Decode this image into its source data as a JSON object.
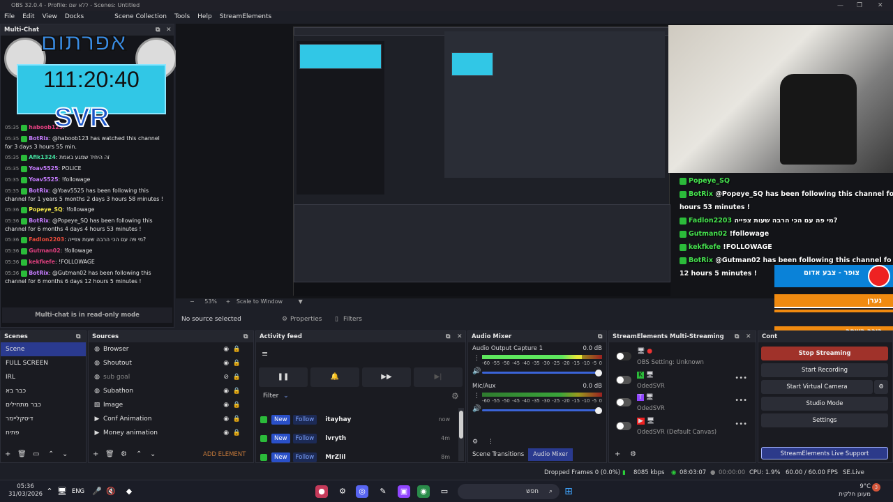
{
  "window": {
    "title": "OBS 32.0.4 - Profile: ללא שם - Scenes: Untitled"
  },
  "menu": [
    "File",
    "Edit",
    "View",
    "Docks",
    "Scene Collection",
    "Tools",
    "Help",
    "StreamElements"
  ],
  "multichat": {
    "title": "Multi-Chat",
    "footer": "Multi-chat is in read-only mode",
    "overlay": {
      "banner": "אפרתום",
      "timer": "111:20:40",
      "brand": "SVR"
    },
    "messages": [
      {
        "ts": "05:35",
        "user": "haboob123",
        "text": "",
        "color": "#e0407f"
      },
      {
        "ts": "05:35",
        "user": "BotRix",
        "text": "@haboob123 has watched this channel for 3 days 3 hours 55 min.",
        "color": "#c77dff"
      },
      {
        "ts": "05:35",
        "user": "Afik1324",
        "text": "זה היחיד שמגע באמת",
        "color": "#44e0a0"
      },
      {
        "ts": "05:35",
        "user": "Yoav5525",
        "text": "POLICE",
        "color": "#c77dff"
      },
      {
        "ts": "05:35",
        "user": "Yoav5525",
        "text": "!followage",
        "color": "#c77dff"
      },
      {
        "ts": "05:35",
        "user": "BotRix",
        "text": "@Yoav5525 has been following this channel for 1 years 5 months 2 days 3 hours 58 minutes !",
        "color": "#c77dff"
      },
      {
        "ts": "05:36",
        "user": "Popeye_SQ",
        "text": "!followage",
        "color": "#f0e44a"
      },
      {
        "ts": "05:36",
        "user": "BotRix",
        "text": "@Popeye_SQ has been following this channel for 6 months 4 days 4 hours 53 minutes !",
        "color": "#c77dff"
      },
      {
        "ts": "05:36",
        "user": "Fadlon2203",
        "text": "מי פה עם הכי הרבה שעות צפייה?",
        "color": "#e84a3a"
      },
      {
        "ts": "05:36",
        "user": "Gutman02",
        "text": "!followage",
        "color": "#e0407f"
      },
      {
        "ts": "05:36",
        "user": "kekfkefe",
        "text": "!FOLLOWAGE",
        "color": "#e0407f"
      },
      {
        "ts": "05:36",
        "user": "BotRix",
        "text": "@Gutman02 has been following this channel for 6 months 6 days 12 hours 5 minutes !",
        "color": "#c77dff"
      }
    ]
  },
  "preview": {
    "zoom": "53%",
    "scale_mode": "Scale to Window",
    "overlay_chat": [
      {
        "user": "Popeye_SQ",
        "text": ""
      },
      {
        "user": "BotRix",
        "text": "@Popeye_SQ has been following this channel fo"
      },
      {
        "user": "",
        "text": "hours 53 minutes !"
      },
      {
        "user": "Fadlon2203",
        "text": "מי פה עם הכי הרבה שעות צפייה?"
      },
      {
        "user": "Gutman02",
        "text": "!followage"
      },
      {
        "user": "kekfkefe",
        "text": "!FOLLOWAGE"
      },
      {
        "user": "BotRix",
        "text": "@Gutman02 has been following this channel fo"
      },
      {
        "user": "",
        "text": "12 hours 5 minutes !"
      }
    ],
    "overlay_panel": {
      "title": "צופר - צבע אדום",
      "rows": [
        "נערן",
        "נתיב הגדוד",
        "כוכב השחר"
      ]
    }
  },
  "context_bar": {
    "status": "No source selected",
    "properties": "Properties",
    "filters": "Filters"
  },
  "scenes": {
    "title": "Scenes",
    "items": [
      "Scene",
      "FULL SCREEN",
      "IRL",
      "כבר בא",
      "כבר מתחילים",
      "דיסקליימר",
      "פתיח"
    ]
  },
  "sources": {
    "title": "Sources",
    "items": [
      {
        "name": "Browser",
        "icon": "globe-icon",
        "hidden": false
      },
      {
        "name": "Shoutout",
        "icon": "globe-icon",
        "hidden": false
      },
      {
        "name": "sub goal",
        "icon": "globe-icon",
        "hidden": true
      },
      {
        "name": "Subathon",
        "icon": "globe-icon",
        "hidden": false
      },
      {
        "name": "Image",
        "icon": "image-icon",
        "hidden": false
      },
      {
        "name": "Conf Animation",
        "icon": "play-icon",
        "hidden": false
      },
      {
        "name": "Money animation",
        "icon": "play-icon",
        "hidden": false
      }
    ],
    "add_element": "ADD ELEMENT"
  },
  "activity_feed": {
    "title": "Activity feed",
    "filter": "Filter",
    "rows": [
      {
        "new": "New",
        "type": "Follow",
        "name": "itayhay",
        "time": "now"
      },
      {
        "new": "New",
        "type": "Follow",
        "name": "lvryth",
        "time": "4m"
      },
      {
        "new": "New",
        "type": "Follow",
        "name": "MrZlil",
        "time": "8m"
      }
    ]
  },
  "audio_mixer": {
    "title": "Audio Mixer",
    "channels": [
      {
        "name": "Audio Output Capture 1",
        "db": "0.0 dB",
        "level": 0.83
      },
      {
        "name": "Mic/Aux",
        "db": "0.0 dB",
        "level": 0.0
      }
    ],
    "scale": [
      "-60",
      "-55",
      "-50",
      "-45",
      "-40",
      "-35",
      "-30",
      "-25",
      "-20",
      "-15",
      "-10",
      "-5",
      "0"
    ],
    "tabs": [
      "Scene Transitions",
      "Audio Mixer"
    ]
  },
  "se_multistreaming": {
    "title": "StreamElements Multi-Streaming",
    "rows": [
      {
        "platform": "monitor-icon",
        "name": "OBS Setting: Unknown"
      },
      {
        "platform": "kick-icon",
        "name": "OdedSVR"
      },
      {
        "platform": "twitch-icon",
        "name": "OdedSVR"
      },
      {
        "platform": "youtube-icon",
        "name": "OdedSVR (Default Canvas)"
      }
    ]
  },
  "controls": {
    "title": "Cont",
    "stop_streaming": "Stop Streaming",
    "start_recording": "Start Recording",
    "start_virtual_camera": "Start Virtual Camera",
    "studio_mode": "Studio Mode",
    "settings": "Settings",
    "support": "StreamElements Live Support"
  },
  "status": {
    "dropped": "Dropped Frames 0 (0.0%)",
    "kbps": "8085 kbps",
    "stream_time": "08:03:07",
    "rec_time": "00:00:00",
    "cpu": "CPU: 1.9%",
    "fps": "60.00 / 60.00 FPS",
    "version": "SE.Live 26.2.5.549"
  },
  "taskbar": {
    "time": "05:36",
    "date": "31/03/2026",
    "lang": "ENG",
    "search": "חפש",
    "weather_temp": "9°C",
    "weather_desc": "מעונן חלקית",
    "notif_count": "3"
  },
  "colors": {
    "accent": "#2a3a8f",
    "stop": "#a0322a",
    "live_support": "#2c3a8a"
  }
}
